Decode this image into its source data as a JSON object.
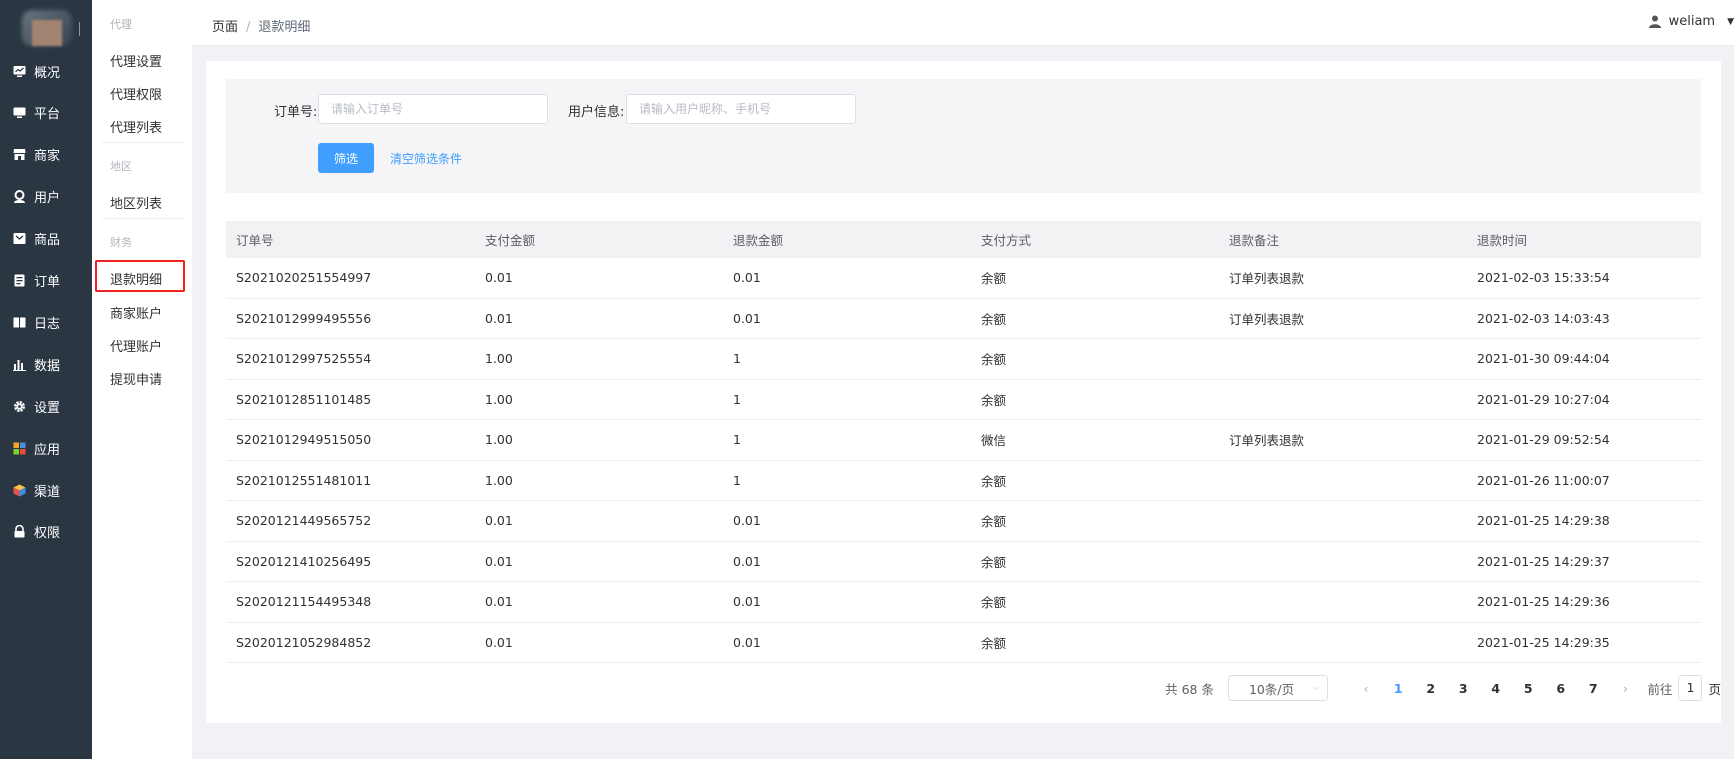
{
  "nav": {
    "items": [
      {
        "label": "概况",
        "icon": "monitor-chart-icon"
      },
      {
        "label": "平台",
        "icon": "monitor-icon"
      },
      {
        "label": "商家",
        "icon": "store-icon"
      },
      {
        "label": "用户",
        "icon": "user-icon"
      },
      {
        "label": "商品",
        "icon": "product-box-icon"
      },
      {
        "label": "订单",
        "icon": "order-doc-icon"
      },
      {
        "label": "日志",
        "icon": "book-icon"
      },
      {
        "label": "数据",
        "icon": "bar-chart-icon"
      },
      {
        "label": "设置",
        "icon": "gear-icon"
      },
      {
        "label": "应用",
        "icon": "apps-grid-icon"
      },
      {
        "label": "渠道",
        "icon": "cube-icon"
      },
      {
        "label": "权限",
        "icon": "lock-icon"
      }
    ]
  },
  "subnav": {
    "groups": [
      {
        "title": "代理",
        "items": [
          "代理设置",
          "代理权限",
          "代理列表"
        ]
      },
      {
        "title": "地区",
        "items": [
          "地区列表"
        ]
      },
      {
        "title": "财务",
        "items": [
          "退款明细",
          "商家账户",
          "代理账户",
          "提现申请"
        ]
      }
    ],
    "active": "退款明细"
  },
  "header": {
    "crumb_root": "页面",
    "crumb_sep": "/",
    "crumb_current": "退款明细",
    "username": "weliam",
    "caret": "▼"
  },
  "filter": {
    "order_label": "订单号:",
    "order_placeholder": "请输入订单号",
    "order_value": "",
    "user_label": "用户信息:",
    "user_placeholder": "请输入用户昵称、手机号",
    "user_value": "",
    "submit_label": "筛选",
    "clear_label": "清空筛选条件"
  },
  "table": {
    "columns": [
      "订单号",
      "支付金额",
      "退款金额",
      "支付方式",
      "退款备注",
      "退款时间"
    ],
    "rows": [
      [
        "S2021020251554997",
        "0.01",
        "0.01",
        "余额",
        "订单列表退款",
        "2021-02-03 15:33:54"
      ],
      [
        "S2021012999495556",
        "0.01",
        "0.01",
        "余额",
        "订单列表退款",
        "2021-02-03 14:03:43"
      ],
      [
        "S2021012997525554",
        "1.00",
        "1",
        "余额",
        "",
        "2021-01-30 09:44:04"
      ],
      [
        "S2021012851101485",
        "1.00",
        "1",
        "余额",
        "",
        "2021-01-29 10:27:04"
      ],
      [
        "S2021012949515050",
        "1.00",
        "1",
        "微信",
        "订单列表退款",
        "2021-01-29 09:52:54"
      ],
      [
        "S2021012551481011",
        "1.00",
        "1",
        "余额",
        "",
        "2021-01-26 11:00:07"
      ],
      [
        "S2020121449565752",
        "0.01",
        "0.01",
        "余额",
        "",
        "2021-01-25 14:29:38"
      ],
      [
        "S2020121410256495",
        "0.01",
        "0.01",
        "余额",
        "",
        "2021-01-25 14:29:37"
      ],
      [
        "S2020121154495348",
        "0.01",
        "0.01",
        "余额",
        "",
        "2021-01-25 14:29:36"
      ],
      [
        "S2020121052984852",
        "0.01",
        "0.01",
        "余额",
        "",
        "2021-01-25 14:29:35"
      ]
    ]
  },
  "pager": {
    "total_text": "共 68 条",
    "page_size": "10条/页",
    "size_arrow": "⌵",
    "prev": "‹",
    "next": "›",
    "pages": [
      "1",
      "2",
      "3",
      "4",
      "5",
      "6",
      "7"
    ],
    "current": "1",
    "goto_prefix": "前往",
    "goto_value": "1",
    "goto_suffix": "页"
  },
  "colors": {
    "nav_bg": "#2b3643",
    "accent": "#409eff",
    "active_outline": "#ee2222"
  }
}
